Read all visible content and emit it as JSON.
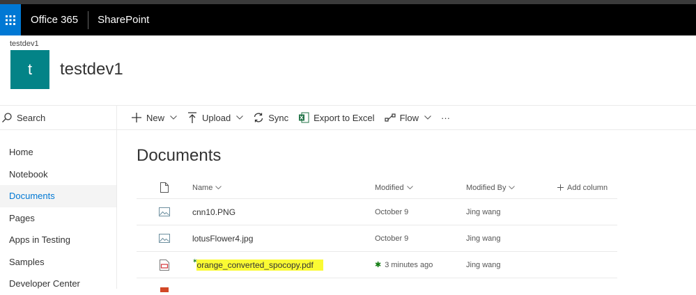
{
  "suite": {
    "brand": "Office 365",
    "app": "SharePoint"
  },
  "site": {
    "breadcrumb": "testdev1",
    "logo_letter": "t",
    "title": "testdev1",
    "logo_color": "#038387"
  },
  "nav": {
    "search_label": "Search",
    "items": [
      {
        "label": "Home"
      },
      {
        "label": "Notebook"
      },
      {
        "label": "Documents"
      },
      {
        "label": "Pages"
      },
      {
        "label": "Apps in Testing"
      },
      {
        "label": "Samples"
      },
      {
        "label": "Developer Center"
      }
    ],
    "active_item": "Documents"
  },
  "commands": {
    "new": "New",
    "upload": "Upload",
    "sync": "Sync",
    "export": "Export to Excel",
    "flow": "Flow",
    "more": "···"
  },
  "library": {
    "title": "Documents",
    "columns": {
      "name": "Name",
      "modified": "Modified",
      "modified_by": "Modified By",
      "add_column": "Add column"
    },
    "rows": [
      {
        "icon": "image-file-icon",
        "name": "cnn10.PNG",
        "modified": "October 9",
        "modified_by": "Jing wang"
      },
      {
        "icon": "image-file-icon",
        "name": "lotusFlower4.jpg",
        "modified": "October 9",
        "modified_by": "Jing wang"
      },
      {
        "icon": "pdf-file-icon",
        "name": "orange_converted_spocopy.pdf",
        "modified": "3 minutes ago",
        "modified_by": "Jing wang",
        "new_marker": "✱"
      }
    ]
  },
  "colors": {
    "suite_bar": "#000000",
    "waffle": "#0078d4",
    "accent": "#0078d4",
    "highlight": "#fafa33",
    "new_marker": "#107c10"
  }
}
